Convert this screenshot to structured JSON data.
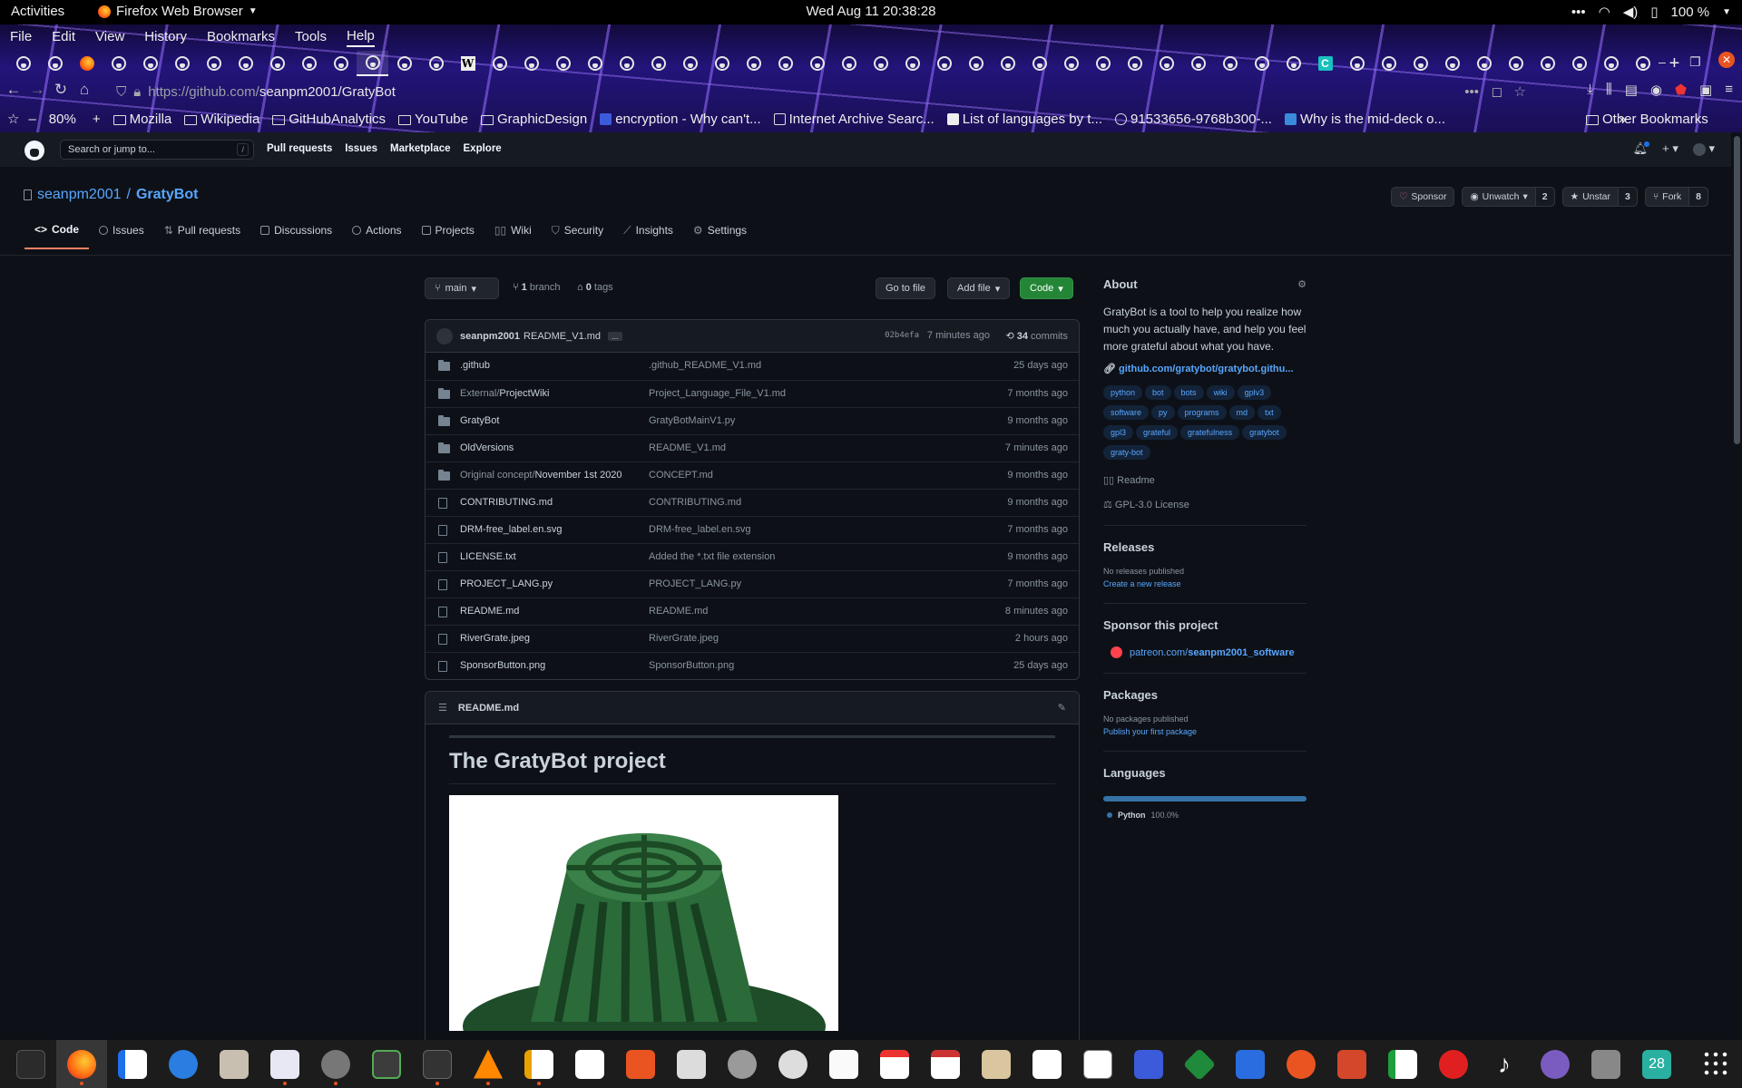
{
  "topbar": {
    "activities": "Activities",
    "app": "Firefox Web Browser",
    "clock": "Wed Aug 11  20:38:28",
    "battery": "100 %"
  },
  "menubar": [
    "File",
    "Edit",
    "View",
    "History",
    "Bookmarks",
    "Tools",
    "Help"
  ],
  "nav": {
    "url_host": "https://github.com/",
    "url_path": "seanpm2001/GratyBot"
  },
  "bookmarks": {
    "zoom": "80%",
    "items": [
      "Mozilla",
      "Wikipedia",
      "GitHubAnalytics",
      "YouTube",
      "GraphicDesign",
      "encryption - Why can't...",
      "Internet Archive Searc...",
      "List of languages by t...",
      "91533656-9768b300-...",
      "Why is the mid-deck o..."
    ],
    "other": "Other Bookmarks"
  },
  "gh": {
    "search_placeholder": "Search or jump to...",
    "slash": "/",
    "nav": [
      "Pull requests",
      "Issues",
      "Marketplace",
      "Explore"
    ]
  },
  "repo": {
    "owner": "seanpm2001",
    "sep": "/",
    "name": "GratyBot",
    "actions": {
      "sponsor": "Sponsor",
      "unwatch": "Unwatch",
      "unwatch_count": "2",
      "unstar": "Unstar",
      "star_count": "3",
      "fork": "Fork",
      "fork_count": "8"
    },
    "tabs": [
      "Code",
      "Issues",
      "Pull requests",
      "Discussions",
      "Actions",
      "Projects",
      "Wiki",
      "Security",
      "Insights",
      "Settings"
    ]
  },
  "branch": {
    "name": "main",
    "branches_n": "1",
    "branches": "branch",
    "tags_n": "0",
    "tags": "tags",
    "goto": "Go to file",
    "add": "Add file",
    "code": "Code"
  },
  "commit": {
    "author": "seanpm2001",
    "message": "README_V1.md",
    "more": "...",
    "hash": "02b4efa",
    "time": "7 minutes ago",
    "commits_n": "34",
    "commits": "commits"
  },
  "files": [
    {
      "dim": "",
      "name": ".github",
      "type": "dir",
      "msg": ".github_README_V1.md",
      "age": "25 days ago"
    },
    {
      "dim": "External/",
      "name": "ProjectWiki",
      "type": "dir",
      "msg": "Project_Language_File_V1.md",
      "age": "7 months ago"
    },
    {
      "dim": "",
      "name": "GratyBot",
      "type": "dir",
      "msg": "GratyBotMainV1.py",
      "age": "9 months ago"
    },
    {
      "dim": "",
      "name": "OldVersions",
      "type": "dir",
      "msg": "README_V1.md",
      "age": "7 minutes ago"
    },
    {
      "dim": "Original concept/",
      "name": "November 1st 2020",
      "type": "dir",
      "msg": "CONCEPT.md",
      "age": "9 months ago"
    },
    {
      "dim": "",
      "name": "CONTRIBUTING.md",
      "type": "file",
      "msg": "CONTRIBUTING.md",
      "age": "9 months ago"
    },
    {
      "dim": "",
      "name": "DRM-free_label.en.svg",
      "type": "file",
      "msg": "DRM-free_label.en.svg",
      "age": "7 months ago"
    },
    {
      "dim": "",
      "name": "LICENSE.txt",
      "type": "file",
      "msg": "Added the *.txt file extension",
      "age": "9 months ago"
    },
    {
      "dim": "",
      "name": "PROJECT_LANG.py",
      "type": "file",
      "msg": "PROJECT_LANG.py",
      "age": "7 months ago"
    },
    {
      "dim": "",
      "name": "README.md",
      "type": "file",
      "msg": "README.md",
      "age": "8 minutes ago"
    },
    {
      "dim": "",
      "name": "RiverGrate.jpeg",
      "type": "file",
      "msg": "RiverGrate.jpeg",
      "age": "2 hours ago"
    },
    {
      "dim": "",
      "name": "SponsorButton.png",
      "type": "file",
      "msg": "SponsorButton.png",
      "age": "25 days ago"
    }
  ],
  "readme": {
    "file": "README.md",
    "title": "The GratyBot project"
  },
  "about": {
    "heading": "About",
    "desc": "GratyBot is a tool to help you realize how much you actually have, and help you feel more grateful about what you have.",
    "link": "github.com/gratybot/gratybot.githu...",
    "topics": [
      "python",
      "bot",
      "bots",
      "wiki",
      "gplv3",
      "software",
      "py",
      "programs",
      "md",
      "txt",
      "gpl3",
      "grateful",
      "gratefulness",
      "gratybot",
      "graty-bot"
    ],
    "readme": "Readme",
    "license": "GPL-3.0 License"
  },
  "releases": {
    "heading": "Releases",
    "none": "No releases published",
    "create": "Create a new release"
  },
  "sponsor": {
    "heading": "Sponsor this project",
    "link_pre": "patreon.com/",
    "link_b": "seanpm2001_software"
  },
  "packages": {
    "heading": "Packages",
    "none": "No packages published",
    "publish": "Publish your first package"
  },
  "languages": {
    "heading": "Languages",
    "name": "Python",
    "pct": "100.0%",
    "color": "#3572A5"
  },
  "dock_badge": "28"
}
